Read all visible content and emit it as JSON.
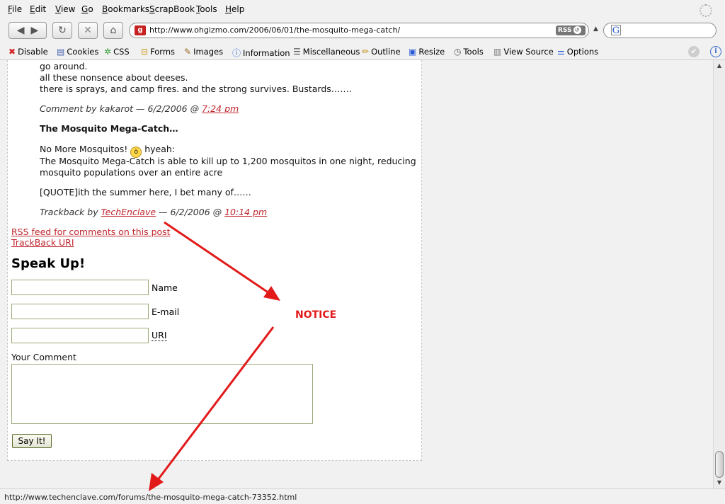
{
  "menu": {
    "items": [
      {
        "u": "F",
        "rest": "ile"
      },
      {
        "u": "E",
        "rest": "dit"
      },
      {
        "u": "V",
        "rest": "iew"
      },
      {
        "u": "G",
        "rest": "o"
      },
      {
        "u": "B",
        "rest": "ookmarks"
      },
      {
        "u": "S",
        "rest": "crapBook"
      },
      {
        "u": "T",
        "rest": "ools"
      },
      {
        "u": "H",
        "rest": "elp"
      }
    ]
  },
  "nav": {
    "url": "http://www.ohgizmo.com/2006/06/01/the-mosquito-mega-catch/",
    "rss_badge": "RSS",
    "search_engine_letter": "G",
    "search_value": ""
  },
  "devbar": {
    "items": [
      {
        "label": "Disable",
        "icon": "disable-icon",
        "glyph": "✖",
        "color": "#d42020"
      },
      {
        "label": "Cookies",
        "icon": "cookies-icon",
        "glyph": "▤",
        "color": "#4a66b0"
      },
      {
        "label": "CSS",
        "icon": "css-icon",
        "glyph": "✲",
        "color": "#2f9a2f"
      },
      {
        "label": "Forms",
        "icon": "forms-icon",
        "glyph": "🔒",
        "color": "#c99a1a"
      },
      {
        "label": "Images",
        "icon": "images-icon",
        "glyph": "✎",
        "color": "#9a6a20"
      },
      {
        "label": "Information",
        "icon": "information-icon",
        "glyph": "ⓘ",
        "color": "#2a5bd7"
      },
      {
        "label": "Miscellaneous",
        "icon": "miscellaneous-icon",
        "glyph": "☰",
        "color": "#555555"
      },
      {
        "label": "Outline",
        "icon": "outline-icon",
        "glyph": "✏",
        "color": "#c48a10"
      },
      {
        "label": "Resize",
        "icon": "resize-icon",
        "glyph": "▣",
        "color": "#2a5bd7"
      },
      {
        "label": "Tools",
        "icon": "tools-icon",
        "glyph": "⚙",
        "color": "#555555"
      },
      {
        "label": "View Source",
        "icon": "view-source-icon",
        "glyph": "▥",
        "color": "#777777"
      },
      {
        "label": "Options",
        "icon": "options-icon",
        "glyph": "⚌",
        "color": "#2a5bd7"
      }
    ]
  },
  "content": {
    "comment_lines": [
      "go around.",
      "all these nonsence about deeses.",
      "there is sprays, and camp fires. and the strong survives. Bustards……."
    ],
    "comment_meta": {
      "prefix": "Comment by kakarot — 6/2/2006 @ ",
      "time": "7:24 pm"
    },
    "trackback_title": "The Mosquito Mega-Catch…",
    "trackback_line1_pre": "No More Mosquitos! ",
    "trackback_line1_post": " hyeah:",
    "trackback_line2": "The Mosquito Mega-Catch is able to kill up to 1,200 mosquitos in one night, reducing",
    "trackback_line3": "mosquito populations over an entire acre",
    "trackback_quote": "[QUOTE]ith the summer here, I bet many of……",
    "trackback_meta": {
      "prefix": "Trackback by ",
      "author": "TechEnclave",
      "middle": " — 6/2/2006 @ ",
      "time": "10:14 pm"
    },
    "rss_comments_link": "RSS feed for comments on this post",
    "trackback_uri_link": "TrackBack URI",
    "form_heading": "Speak Up!",
    "name_label": "Name",
    "email_label": "E-mail",
    "uri_label": "URI",
    "name_value": "",
    "email_value": "",
    "uri_value": "",
    "comment_label": "Your Comment",
    "comment_value": "",
    "submit_label": "Say It!",
    "annotation": "NOTICE"
  },
  "status": {
    "text": "http://www.techenclave.com/forums/the-mosquito-mega-catch-73352.html"
  },
  "colors": {
    "link": "#c0262e",
    "annotation_arrow": "#e21a1a"
  }
}
